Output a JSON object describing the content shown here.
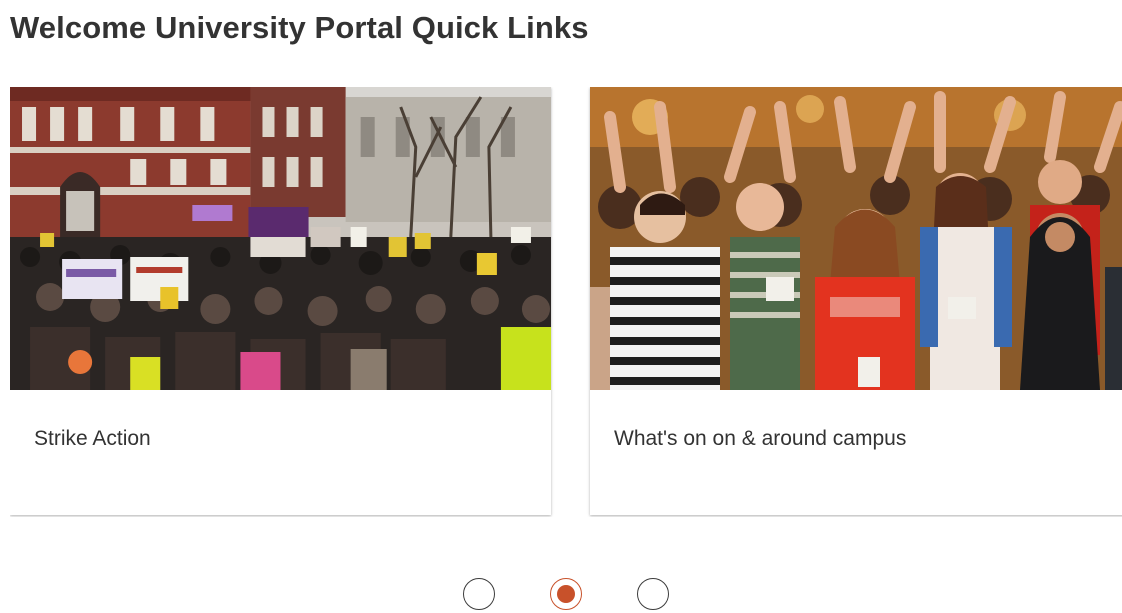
{
  "page": {
    "title": "Welcome University Portal Quick Links"
  },
  "carousel": {
    "cards": [
      {
        "title": "Strike Action",
        "image": "protest-crowd-street-photo"
      },
      {
        "title": "What's on on & around campus",
        "image": "students-raising-hands-photo"
      }
    ],
    "pager": {
      "count": 3,
      "selected_index": 1
    }
  },
  "colors": {
    "accent": "#c8512a",
    "title_text": "#333333",
    "dot_border": "#3c3c3c"
  }
}
